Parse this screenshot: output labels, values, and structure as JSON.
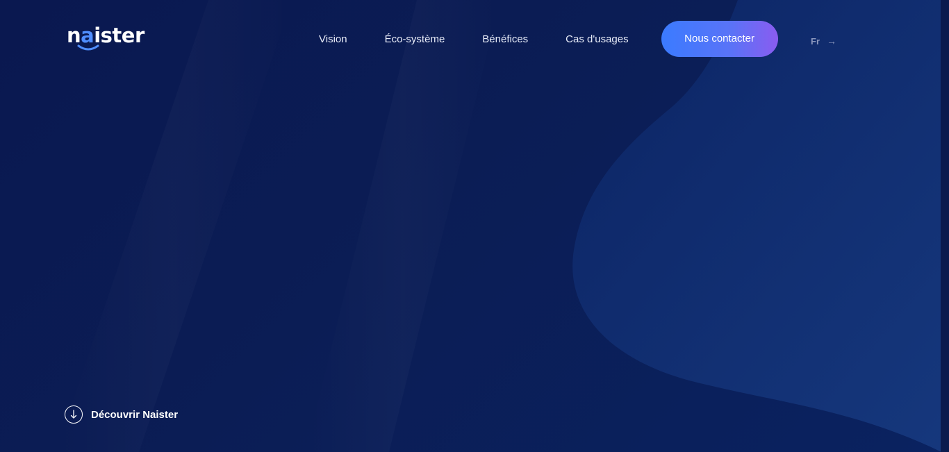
{
  "brand": {
    "logo_prefix": "n",
    "logo_accent": "a",
    "logo_suffix": "ister",
    "accent_color": "#4f8dff"
  },
  "nav": {
    "items": [
      {
        "label": "Vision"
      },
      {
        "label": "Éco-système"
      },
      {
        "label": "Bénéfices"
      },
      {
        "label": "Cas d'usages"
      }
    ],
    "cta_label": "Nous contacter",
    "cta_gradient": [
      "#3b7bff",
      "#8a5cf0"
    ]
  },
  "language": {
    "label": "Fr",
    "arrow": "→"
  },
  "hero": {
    "discover_label": "Découvrir Naister",
    "discover_icon": "arrow-down-circle-icon"
  },
  "colors": {
    "background": "#0b1a4e",
    "shape": "#143272"
  }
}
